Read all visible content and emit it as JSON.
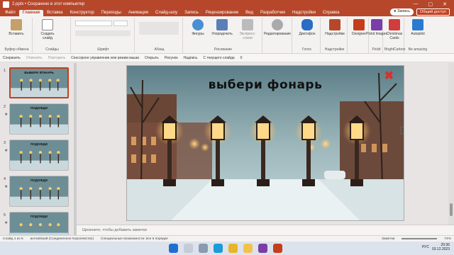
{
  "titlebar": {
    "title": "2.pptx • Сохранено в этот компьютер",
    "min": "—",
    "max": "▢",
    "close": "✕"
  },
  "tabs": [
    "Файл",
    "Главная",
    "Вставка",
    "Конструктор",
    "Переходы",
    "Анимация",
    "Слайд-шоу",
    "Запись",
    "Рецензирование",
    "Вид",
    "Разработчик",
    "Надстройки",
    "Справка"
  ],
  "active_tab": 1,
  "record_label": "Запись",
  "share_label": "Общий доступ",
  "ribbon": {
    "groups": [
      "Буфер обмена",
      "Слайды",
      "Шрифт",
      "Абзац",
      "Рисование",
      "Голос",
      "Надстройки",
      "Pickit",
      "BrightCarbon",
      "Be amazing"
    ],
    "buttons": {
      "paste": "Вставить",
      "new_slide": "Создать слайд",
      "shapes": "Фигуры",
      "arrange": "Упорядочить",
      "express": "Экспресс-стили",
      "editing": "Редактирование",
      "dictate": "Диктофон",
      "addins": "Надстройки",
      "designer": "Designer",
      "pickit": "Pickit Images",
      "christmas": "Christmas Cards",
      "autopilot": "Autopilot"
    }
  },
  "qat": [
    "Сохранить",
    "Отменить",
    "Повторить",
    "Сенсорное управление или режим мыши",
    "Открыть",
    "Рисунок",
    "Надпись",
    "С текущего слайда",
    "0"
  ],
  "thumbnails": [
    {
      "num": "1",
      "title": "ВЫБЕРИ ФОНАРЬ",
      "selected": true,
      "star": ""
    },
    {
      "num": "2",
      "title": "ПОДОЖДИ",
      "selected": false,
      "star": "★"
    },
    {
      "num": "3",
      "title": "ПОДОЖДИ",
      "selected": false,
      "star": "★"
    },
    {
      "num": "4",
      "title": "ПОДОЖДИ",
      "selected": false,
      "star": "★"
    },
    {
      "num": "5",
      "title": "ПОДОЖДИ",
      "selected": false,
      "star": "★"
    }
  ],
  "slide": {
    "title": "выбери фонарь",
    "close_mark": "✖"
  },
  "notes_placeholder": "Щелкните, чтобы добавить заметки",
  "status": {
    "slide_info": "Слайд 1 из 5",
    "language": "английский (Соединенное Королевство)",
    "accessibility": "Специальные возможности: все в порядке",
    "notes": "Заметки",
    "zoom": "74%"
  },
  "tray": {
    "lang": "РУС",
    "time": "20:36",
    "date": "03.12.2023"
  }
}
